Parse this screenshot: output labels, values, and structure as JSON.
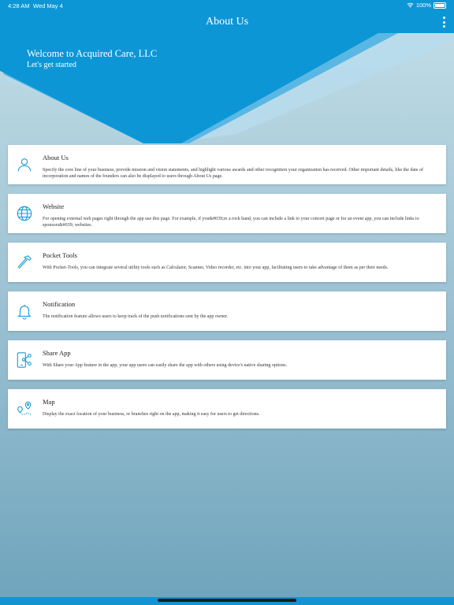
{
  "status_bar": {
    "time": "4:28 AM",
    "date": "Wed May 4",
    "battery": "100%"
  },
  "header": {
    "title": "About Us"
  },
  "hero": {
    "welcome": "Welcome to  Acquired Care, LLC",
    "subtitle": "Let's get started"
  },
  "colors": {
    "primary": "#0d96d6",
    "icon": "#1a9bd7"
  },
  "cards": [
    {
      "icon": "person-icon",
      "title": "About Us",
      "description": "Specify the core line of your business, provide mission and vision statements, and highlight various awards and other recognition your organization has received. Other important details, like the date of incorporation and names of the founders can also be displayed to users through About Us page."
    },
    {
      "icon": "globe-icon",
      "title": "Website",
      "description": "For opening external web pages right through the app use this page. For example, if you&#039;re a rock band, you can include a link to your concert page or for an event app, you can include links to sponsors&#039; websites."
    },
    {
      "icon": "hammer-icon",
      "title": "Pocket Tools",
      "description": "With Pocket-Tools, you can integrate several utility tools such as Calculator, Scanner, Video recorder, etc. into your app, facilitating users to take advantage of them as per their needs."
    },
    {
      "icon": "bell-icon",
      "title": "Notification",
      "description": "The notification feature allows users to keep track of the push notifications sent by the app owner."
    },
    {
      "icon": "share-icon",
      "title": "Share App",
      "description": "With Share your App feature in the app, your app users can easily share the app with others using device's native sharing options."
    },
    {
      "icon": "map-pin-icon",
      "title": "Map",
      "description": "Display the exact location of your business, or branches right on the app, making it easy for users to get directions."
    }
  ]
}
